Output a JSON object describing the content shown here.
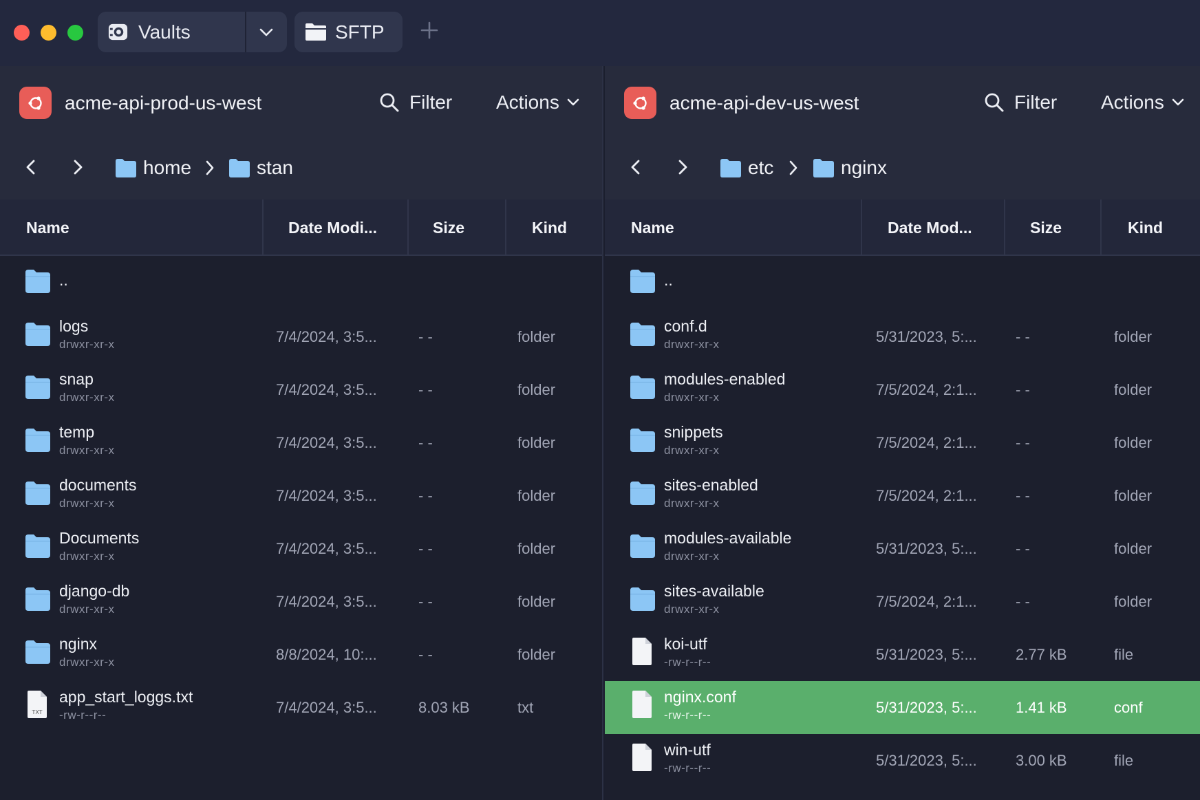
{
  "tabs": [
    {
      "label": "Vaults",
      "icon": "vault-icon"
    },
    {
      "label": "SFTP",
      "icon": "folder-icon"
    }
  ],
  "left": {
    "host": "acme-api-prod-us-west",
    "filter_label": "Filter",
    "actions_label": "Actions",
    "breadcrumb": [
      "home",
      "stan"
    ],
    "columns": [
      "Name",
      "Date Modi...",
      "Size",
      "Kind"
    ],
    "rows": [
      {
        "name": "..",
        "perm": "",
        "date": "",
        "size": "",
        "kind": "",
        "type": "folder"
      },
      {
        "name": "logs",
        "perm": "drwxr-xr-x",
        "date": "7/4/2024, 3:5...",
        "size": "- -",
        "kind": "folder",
        "type": "folder"
      },
      {
        "name": "snap",
        "perm": "drwxr-xr-x",
        "date": "7/4/2024, 3:5...",
        "size": "- -",
        "kind": "folder",
        "type": "folder"
      },
      {
        "name": "temp",
        "perm": "drwxr-xr-x",
        "date": "7/4/2024, 3:5...",
        "size": "- -",
        "kind": "folder",
        "type": "folder"
      },
      {
        "name": "documents",
        "perm": "drwxr-xr-x",
        "date": "7/4/2024, 3:5...",
        "size": "- -",
        "kind": "folder",
        "type": "folder"
      },
      {
        "name": "Documents",
        "perm": "drwxr-xr-x",
        "date": "7/4/2024, 3:5...",
        "size": "- -",
        "kind": "folder",
        "type": "folder"
      },
      {
        "name": "django-db",
        "perm": "drwxr-xr-x",
        "date": "7/4/2024, 3:5...",
        "size": "- -",
        "kind": "folder",
        "type": "folder"
      },
      {
        "name": "nginx",
        "perm": "drwxr-xr-x",
        "date": "8/8/2024, 10:...",
        "size": "- -",
        "kind": "folder",
        "type": "folder"
      },
      {
        "name": "app_start_loggs.txt",
        "perm": "-rw-r--r--",
        "date": "7/4/2024, 3:5...",
        "size": "8.03 kB",
        "kind": "txt",
        "type": "txt"
      }
    ]
  },
  "right": {
    "host": "acme-api-dev-us-west",
    "filter_label": "Filter",
    "actions_label": "Actions",
    "breadcrumb": [
      "etc",
      "nginx"
    ],
    "columns": [
      "Name",
      "Date Mod...",
      "Size",
      "Kind"
    ],
    "rows": [
      {
        "name": "..",
        "perm": "",
        "date": "",
        "size": "",
        "kind": "",
        "type": "folder"
      },
      {
        "name": "conf.d",
        "perm": "drwxr-xr-x",
        "date": "5/31/2023, 5:...",
        "size": "- -",
        "kind": "folder",
        "type": "folder"
      },
      {
        "name": "modules-enabled",
        "perm": "drwxr-xr-x",
        "date": "7/5/2024, 2:1...",
        "size": "- -",
        "kind": "folder",
        "type": "folder"
      },
      {
        "name": "snippets",
        "perm": "drwxr-xr-x",
        "date": "7/5/2024, 2:1...",
        "size": "- -",
        "kind": "folder",
        "type": "folder"
      },
      {
        "name": "sites-enabled",
        "perm": "drwxr-xr-x",
        "date": "7/5/2024, 2:1...",
        "size": "- -",
        "kind": "folder",
        "type": "folder"
      },
      {
        "name": "modules-available",
        "perm": "drwxr-xr-x",
        "date": "5/31/2023, 5:...",
        "size": "- -",
        "kind": "folder",
        "type": "folder"
      },
      {
        "name": "sites-available",
        "perm": "drwxr-xr-x",
        "date": "7/5/2024, 2:1...",
        "size": "- -",
        "kind": "folder",
        "type": "folder"
      },
      {
        "name": "koi-utf",
        "perm": "-rw-r--r--",
        "date": "5/31/2023, 5:...",
        "size": "2.77 kB",
        "kind": "file",
        "type": "file"
      },
      {
        "name": "nginx.conf",
        "perm": "-rw-r--r--",
        "date": "5/31/2023, 5:...",
        "size": "1.41 kB",
        "kind": "conf",
        "type": "file",
        "selected": true
      },
      {
        "name": "win-utf",
        "perm": "-rw-r--r--",
        "date": "5/31/2023, 5:...",
        "size": "3.00 kB",
        "kind": "file",
        "type": "file"
      }
    ]
  },
  "colors": {
    "accent_selected": "#5aaf6c",
    "host_icon": "#e85d58",
    "folder": "#8cc6f5"
  }
}
